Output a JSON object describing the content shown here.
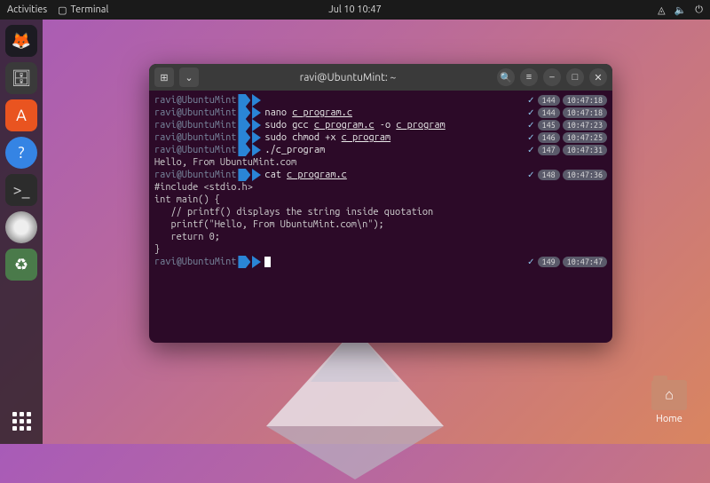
{
  "topbar": {
    "activities": "Activities",
    "app_label": "Terminal",
    "clock": "Jul 10  10:47"
  },
  "dock": {
    "icons": [
      "firefox",
      "files",
      "software",
      "help",
      "terminal",
      "rhythmbox",
      "trash"
    ]
  },
  "desktop": {
    "home_label": "Home"
  },
  "terminal": {
    "title": "ravi@UbuntuMint: ~",
    "prompt_user": "ravi@UbuntuMint",
    "lines": [
      {
        "cmd": "",
        "hist": "144",
        "time": "10:47:18"
      },
      {
        "cmd": "nano ",
        "file": "c_program.c",
        "hist": "144",
        "time": "10:47:18"
      },
      {
        "cmd": "sudo gcc ",
        "file": "c_program.c",
        "suffix": " -o ",
        "file2": "c_program",
        "hist": "145",
        "time": "10:47:23"
      },
      {
        "cmd": "sudo chmod +x ",
        "file": "c_program",
        "hist": "146",
        "time": "10:47:25"
      },
      {
        "cmd": "./c_program",
        "hist": "147",
        "time": "10:47:31"
      }
    ],
    "output1": "Hello, From UbuntuMint.com",
    "cat_line": {
      "cmd": "cat ",
      "file": "c_program.c",
      "hist": "148",
      "time": "10:47:36"
    },
    "file_content": [
      "#include <stdio.h>",
      "int main() {",
      "   // printf() displays the string inside quotation",
      "   printf(\"Hello, From UbuntuMint.com\\n\");",
      "   return 0;",
      "}"
    ],
    "prompt_line": {
      "hist": "149",
      "time": "10:47:47"
    }
  }
}
